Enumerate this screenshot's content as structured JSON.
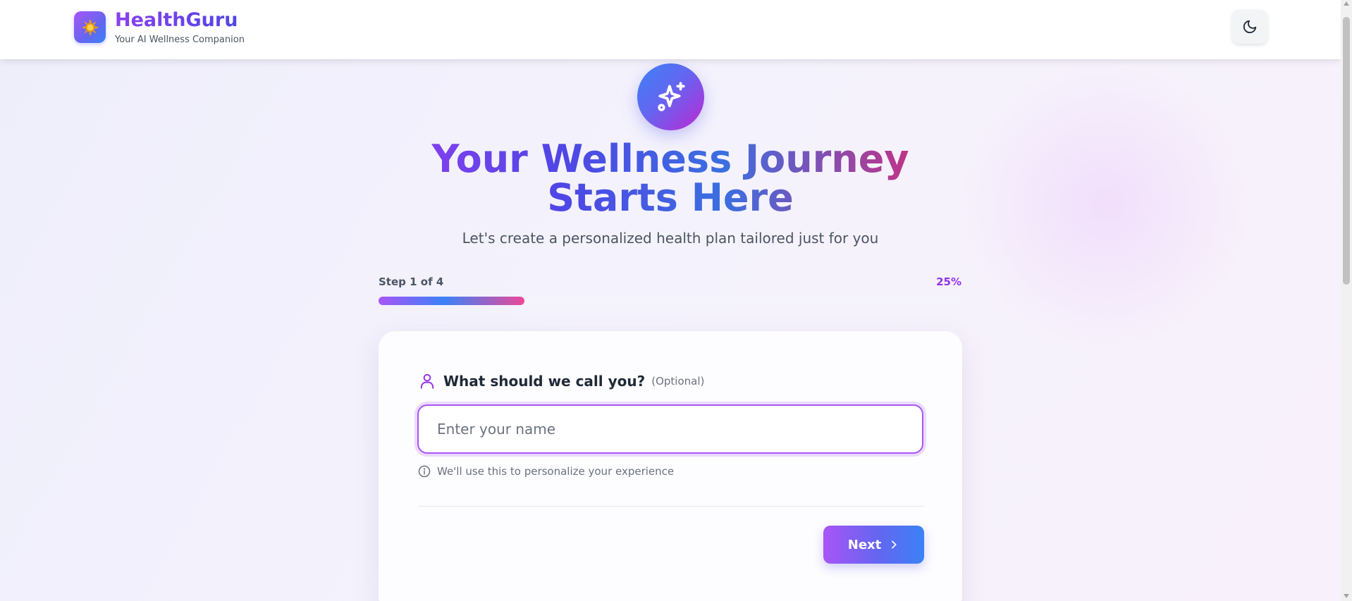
{
  "header": {
    "brand_title": "HealthGuru",
    "brand_subtitle": "Your AI Wellness Companion",
    "logo_icon": "sun-icon",
    "theme_toggle_icon": "moon-icon"
  },
  "hero": {
    "icon": "sparkles-icon",
    "title": "Your Wellness Journey Starts Here",
    "subtitle": "Let's create a personalized health plan tailored just for you"
  },
  "progress": {
    "step_label": "Step 1 of 4",
    "percent_label": "25%",
    "fraction": 0.25
  },
  "form": {
    "label_icon": "user-icon",
    "label": "What should we call you?",
    "optional_label": "(Optional)",
    "name_value": "",
    "name_placeholder": "Enter your name",
    "hint_icon": "info-icon",
    "hint": "We'll use this to personalize your experience",
    "next_label": "Next",
    "next_icon": "chevron-right-icon"
  },
  "colors": {
    "brand_purple": "#9333ea",
    "brand_indigo": "#6366f1",
    "brand_blue": "#3b82f6",
    "brand_pink": "#db2777"
  }
}
